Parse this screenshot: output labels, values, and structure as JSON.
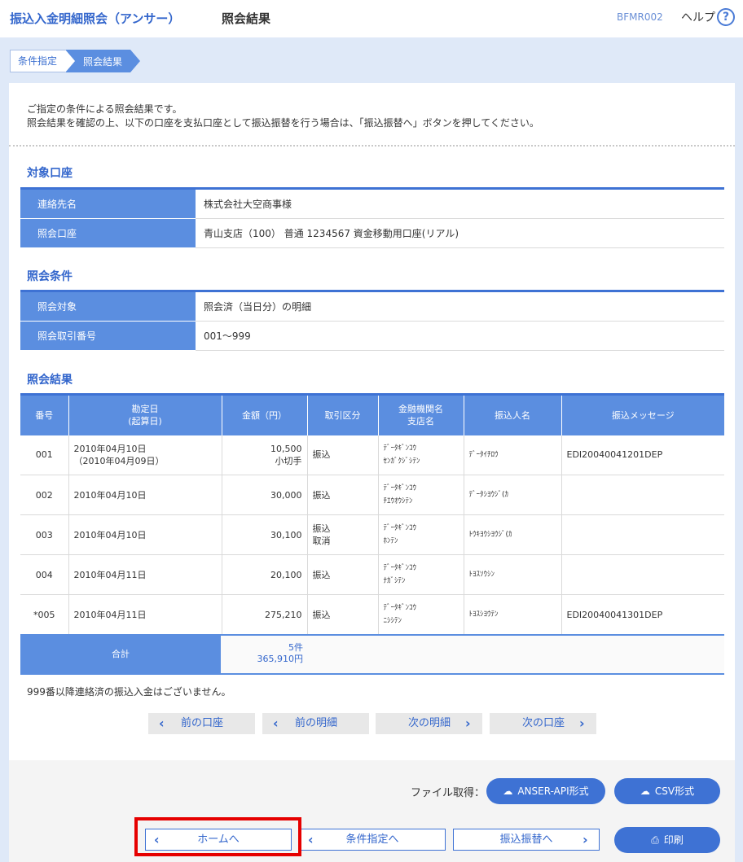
{
  "header": {
    "title": "振込入金明細照会（アンサー）",
    "subtitle": "照会結果",
    "screen_code": "BFMR002",
    "help_label": "ヘルプ",
    "help_icon": "?"
  },
  "breadcrumb": {
    "step1": "条件指定",
    "step2": "照会結果"
  },
  "intro": {
    "line1": "ご指定の条件による照会結果です。",
    "line2": "照会結果を確認の上、以下の口座を支払口座として振込振替を行う場合は、「振込振替へ」ボタンを押してください。"
  },
  "account_section": {
    "title": "対象口座",
    "rows": [
      {
        "label": "連絡先名",
        "value": "株式会社大空商事様"
      },
      {
        "label": "照会口座",
        "value": "青山支店（100） 普通 1234567 資金移動用口座(リアル)"
      }
    ]
  },
  "condition_section": {
    "title": "照会条件",
    "rows": [
      {
        "label": "照会対象",
        "value": "照会済（当日分）の明細"
      },
      {
        "label": "照会取引番号",
        "value": "001～999"
      }
    ]
  },
  "result_section": {
    "title": "照会結果",
    "columns": {
      "no": "番号",
      "date1": "勘定日",
      "date2": "(起算日)",
      "amount": "金額（円）",
      "type": "取引区分",
      "bank1": "金融機関名",
      "bank2": "支店名",
      "payer": "振込人名",
      "message": "振込メッセージ"
    },
    "rows": [
      {
        "no": "001",
        "date": "2010年04月10日",
        "date2": "（2010年04月09日）",
        "amount": "10,500",
        "amount2": "小切手",
        "type": "振込",
        "type2": "",
        "bank": "ﾃﾞｰﾀｷﾞﾝｺｳ",
        "branch": "ｾﾝｶﾞｸｼﾞｼﾃﾝ",
        "payer": "ﾃﾞｰﾀｲﾁﾛｳ",
        "message": "EDI20040041201DEP"
      },
      {
        "no": "002",
        "date": "2010年04月10日",
        "date2": "",
        "amount": "30,000",
        "amount2": "",
        "type": "振込",
        "type2": "",
        "bank": "ﾃﾞｰﾀｷﾞﾝｺｳ",
        "branch": "ﾁｴｳｵｳｼﾃﾝ",
        "payer": "ﾃﾞｰﾀｼﾖｳｼﾞ(ｶ",
        "message": ""
      },
      {
        "no": "003",
        "date": "2010年04月10日",
        "date2": "",
        "amount": "30,100",
        "amount2": "",
        "type": "振込",
        "type2": "取消",
        "bank": "ﾃﾞｰﾀｷﾞﾝｺｳ",
        "branch": "ﾎﾝﾃﾝ",
        "payer": "ﾄｳｷﾖｳｼﾖｳｼﾞ(ｶ",
        "message": ""
      },
      {
        "no": "004",
        "date": "2010年04月11日",
        "date2": "",
        "amount": "20,100",
        "amount2": "",
        "type": "振込",
        "type2": "",
        "bank": "ﾃﾞｰﾀｷﾞﾝｺｳ",
        "branch": "ﾅｶﾞｼﾃﾝ",
        "payer": "ﾄﾖｽｿｳｼﾝ",
        "message": ""
      },
      {
        "no": "*005",
        "date": "2010年04月11日",
        "date2": "",
        "amount": "275,210",
        "amount2": "",
        "type": "振込",
        "type2": "",
        "bank": "ﾃﾞｰﾀｷﾞﾝｺｳ",
        "branch": "ﾆｼｼﾃﾝ",
        "payer": "ﾄﾖｽｼﾖｳﾃﾝ",
        "message": "EDI20040041301DEP"
      }
    ],
    "total_label": "合計",
    "total_count": "5件",
    "total_amount": "365,910円",
    "note": "999番以降連絡済の振込入金はございません。"
  },
  "pager": {
    "prev_account": "前の口座",
    "prev_detail": "前の明細",
    "next_detail": "次の明細",
    "next_account": "次の口座"
  },
  "footer": {
    "file_label": "ファイル取得：",
    "anser_api": "ANSER-API形式",
    "csv": "CSV形式",
    "home": "ホームへ",
    "condition": "条件指定へ",
    "transfer": "振込振替へ",
    "print": "印刷"
  },
  "colors": {
    "accent": "#3e72d4",
    "header_cell": "#5b8ee0",
    "highlight": "#e60000"
  }
}
